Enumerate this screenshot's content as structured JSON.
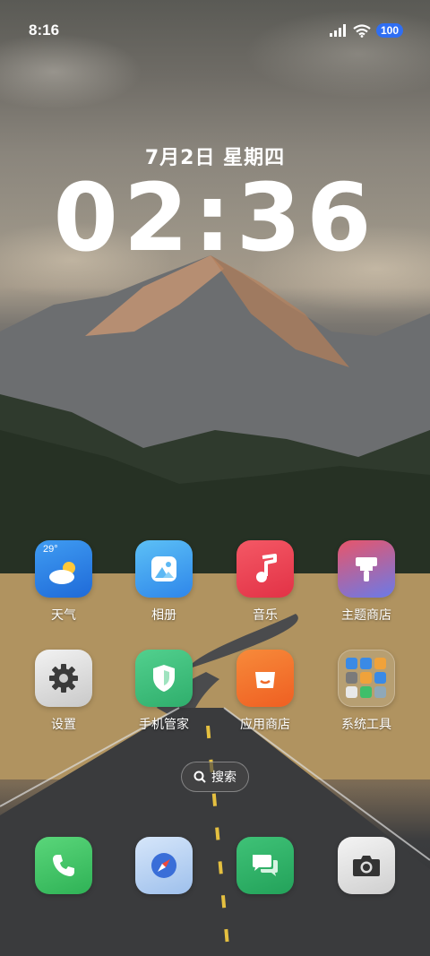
{
  "status_bar": {
    "time": "8:16",
    "battery": "100",
    "icons": [
      "signal-icon",
      "wifi-icon",
      "battery-icon"
    ]
  },
  "lockscreen": {
    "date": "7月2日 星期四",
    "clock": "02:36"
  },
  "apps": [
    {
      "name": "weather",
      "label": "天气",
      "temp": "29°",
      "icon": "weather-icon",
      "color": "#2f7ee8"
    },
    {
      "name": "gallery",
      "label": "相册",
      "icon": "gallery-icon",
      "color": "#3fa0f0"
    },
    {
      "name": "music",
      "label": "音乐",
      "icon": "music-note-icon",
      "color": "#ee4050"
    },
    {
      "name": "theme-store",
      "label": "主题商店",
      "icon": "brush-icon",
      "color": "#c05a8a"
    },
    {
      "name": "settings",
      "label": "设置",
      "icon": "gear-icon",
      "color": "#d8d8d8"
    },
    {
      "name": "phone-manager",
      "label": "手机管家",
      "icon": "shield-icon",
      "color": "#3fbf7c"
    },
    {
      "name": "app-store",
      "label": "应用商店",
      "icon": "shopping-bag-icon",
      "color": "#f06a2a"
    },
    {
      "name": "system-tools",
      "label": "系统工具",
      "icon": "folder-icon",
      "color": "#9a8a6a"
    }
  ],
  "search": {
    "label": "搜索"
  },
  "dock": [
    {
      "name": "phone",
      "icon": "phone-icon",
      "color": "#3dc465"
    },
    {
      "name": "browser",
      "icon": "compass-icon",
      "color": "#a8c8f0"
    },
    {
      "name": "messages",
      "icon": "chat-bubble-icon",
      "color": "#2fb36a"
    },
    {
      "name": "camera",
      "icon": "camera-icon",
      "color": "#e6e6e6"
    }
  ]
}
